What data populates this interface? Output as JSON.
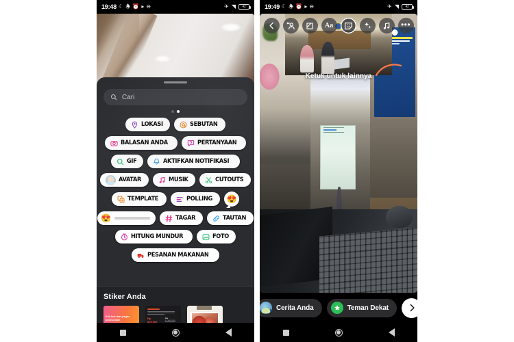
{
  "left_phone": {
    "status_bar": {
      "time": "19:48",
      "icons": [
        "moon-icon",
        "vibrate-mute-icon",
        "alarm-icon",
        "play-icon",
        "dnd-icon"
      ],
      "right_icons": [
        "airplane-icon",
        "wifi-icon"
      ],
      "battery_level": "42"
    },
    "sheet": {
      "grabber": "drag-handle",
      "search": {
        "placeholder": "Cari",
        "icon": "search-icon"
      },
      "page_dots": {
        "count": 2,
        "active_index": 1
      },
      "sticker_rows": [
        [
          {
            "label": "LOKASI",
            "icon": "location-pin-icon",
            "color": "#8f3fd1"
          },
          {
            "label": "SEBUTAN",
            "icon": "mention-at-icon",
            "color": "#f0821e"
          }
        ],
        [
          {
            "label": "BALASAN ANDA",
            "icon": "camera-icon",
            "color": "#ec2f8c"
          },
          {
            "label": "PERTANYAAN",
            "icon": "question-box-icon",
            "color": "#d92fa8"
          }
        ],
        [
          {
            "label": "GIF",
            "icon": "search-icon",
            "color": "#1fbf72"
          },
          {
            "label": "AKTIFKAN NOTIFIKASI",
            "icon": "bell-icon",
            "color": "#2e9bf0"
          }
        ],
        [
          {
            "label": "AVATAR",
            "icon": "avatar-icon",
            "color": "#9ec6dc"
          },
          {
            "label": "MUSIK",
            "icon": "music-note-icon",
            "color": "#ec2f8c"
          },
          {
            "label": "CUTOUTS",
            "icon": "scissors-icon",
            "color": "#2fc07a"
          }
        ],
        [
          {
            "label": "TEMPLATE",
            "icon": "template-icon",
            "color": "#f0821e"
          },
          {
            "label": "POLLING",
            "icon": "poll-bars-icon",
            "color": "#9b3fd1"
          },
          {
            "label": "",
            "icon": "emoji-reaction-icon",
            "emoji": "😍"
          }
        ],
        [
          {
            "label": "",
            "icon": "emoji-slider-icon",
            "emoji": "😍"
          },
          {
            "label": "TAGAR",
            "icon": "hashtag-icon",
            "color": "#ec2f8c"
          },
          {
            "label": "TAUTAN",
            "icon": "link-icon",
            "color": "#2e9bf0"
          }
        ],
        [
          {
            "label": "HITUNG MUNDUR",
            "icon": "countdown-clock-icon",
            "color": "#d92fa8"
          },
          {
            "label": "FOTO",
            "icon": "photo-icon",
            "color": "#2fc07a"
          }
        ],
        [
          {
            "label": "PESANAN MAKANAN",
            "icon": "delivery-truck-icon",
            "color": "#e4342b"
          }
        ]
      ],
      "my_stickers": {
        "title": "Stiker Anda",
        "thumbnails": [
          {
            "name": "sticker-thumb-promo",
            "caption": "Klik link dan jangan promosikan"
          },
          {
            "name": "sticker-thumb-product-card",
            "price": "Rp 600.000",
            "old_price": "Rp 1.000.000"
          },
          {
            "name": "sticker-thumb-polaroid"
          }
        ]
      }
    },
    "nav_bar": [
      "recents-square-icon",
      "home-circle-icon",
      "back-triangle-icon"
    ]
  },
  "right_phone": {
    "status_bar": {
      "time": "19:49",
      "icons": [
        "moon-icon",
        "vibrate-mute-icon",
        "alarm-icon",
        "play-icon",
        "dnd-icon"
      ],
      "right_icons": [
        "airplane-icon",
        "wifi-icon"
      ],
      "battery_level": "42"
    },
    "toolbar": [
      {
        "name": "back-button",
        "icon": "chevron-left-icon",
        "selected": false
      },
      {
        "name": "tag-people-button",
        "icon": "add-person-icon",
        "selected": false
      },
      {
        "name": "resize-button",
        "icon": "crop-expand-icon",
        "selected": false
      },
      {
        "name": "text-button",
        "icon": "text-aa-icon",
        "label": "Aa",
        "selected": false
      },
      {
        "name": "sticker-button",
        "icon": "sticker-smiley-icon",
        "selected": true
      },
      {
        "name": "effects-button",
        "icon": "sparkles-icon",
        "selected": false
      },
      {
        "name": "music-button",
        "icon": "music-note-icon",
        "selected": false
      },
      {
        "name": "more-button",
        "icon": "more-dots-icon",
        "selected": false
      }
    ],
    "canvas": {
      "tap_hint": "Ketuk untuk lainnya",
      "cue": "orange-arrow-annotation"
    },
    "bottom_actions": [
      {
        "name": "your-story-button",
        "label": "Cerita Anda",
        "icon": "profile-avatar-icon"
      },
      {
        "name": "close-friends-button",
        "label": "Teman Dekat",
        "icon": "green-star-icon",
        "color": "#2dbd55"
      },
      {
        "name": "share-next-button",
        "icon": "chevron-right-icon"
      }
    ],
    "nav_bar": [
      "recents-square-icon",
      "home-circle-icon",
      "back-triangle-icon"
    ]
  }
}
